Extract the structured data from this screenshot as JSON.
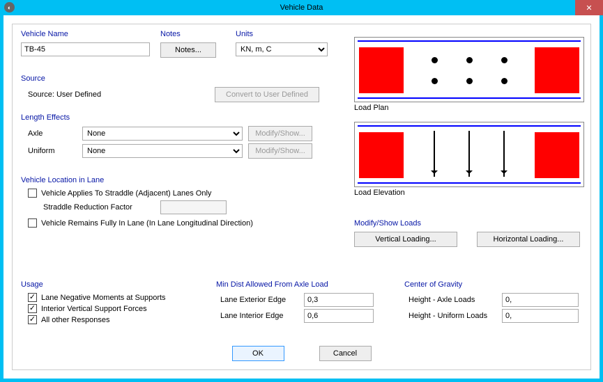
{
  "window": {
    "title": "Vehicle Data",
    "close_icon": "✕"
  },
  "vehicle_name": {
    "title": "Vehicle Name",
    "value": "TB-45"
  },
  "notes": {
    "title": "Notes",
    "button": "Notes..."
  },
  "units": {
    "title": "Units",
    "value": "KN, m, C"
  },
  "source": {
    "title": "Source",
    "label": "Source: User Defined",
    "convert_btn": "Convert to User Defined"
  },
  "length_effects": {
    "title": "Length Effects",
    "axle_label": "Axle",
    "axle_value": "None",
    "axle_btn": "Modify/Show...",
    "uniform_label": "Uniform",
    "uniform_value": "None",
    "uniform_btn": "Modify/Show..."
  },
  "location": {
    "title": "Vehicle Location in Lane",
    "straddle": "Vehicle Applies To Straddle (Adjacent) Lanes Only",
    "reduction": "Straddle Reduction Factor",
    "remains": "Vehicle Remains Fully In Lane (In Lane Longitudinal Direction)"
  },
  "usage": {
    "title": "Usage",
    "neg": "Lane Negative Moments at Supports",
    "int": "Interior Vertical Support Forces",
    "all": "All other Responses"
  },
  "min_dist": {
    "title": "Min Dist Allowed From Axle Load",
    "ext_label": "Lane Exterior Edge",
    "ext_value": "0,3",
    "int_label": "Lane Interior Edge",
    "int_value": "0,6"
  },
  "cog": {
    "title": "Center of Gravity",
    "axle_label": "Height - Axle Loads",
    "axle_value": "0,",
    "unif_label": "Height - Uniform Loads",
    "unif_value": "0,"
  },
  "previews": {
    "plan": "Load Plan",
    "elev": "Load Elevation"
  },
  "loads": {
    "title": "Modify/Show Loads",
    "vertical": "Vertical Loading...",
    "horizontal": "Horizontal Loading..."
  },
  "actions": {
    "ok": "OK",
    "cancel": "Cancel"
  }
}
